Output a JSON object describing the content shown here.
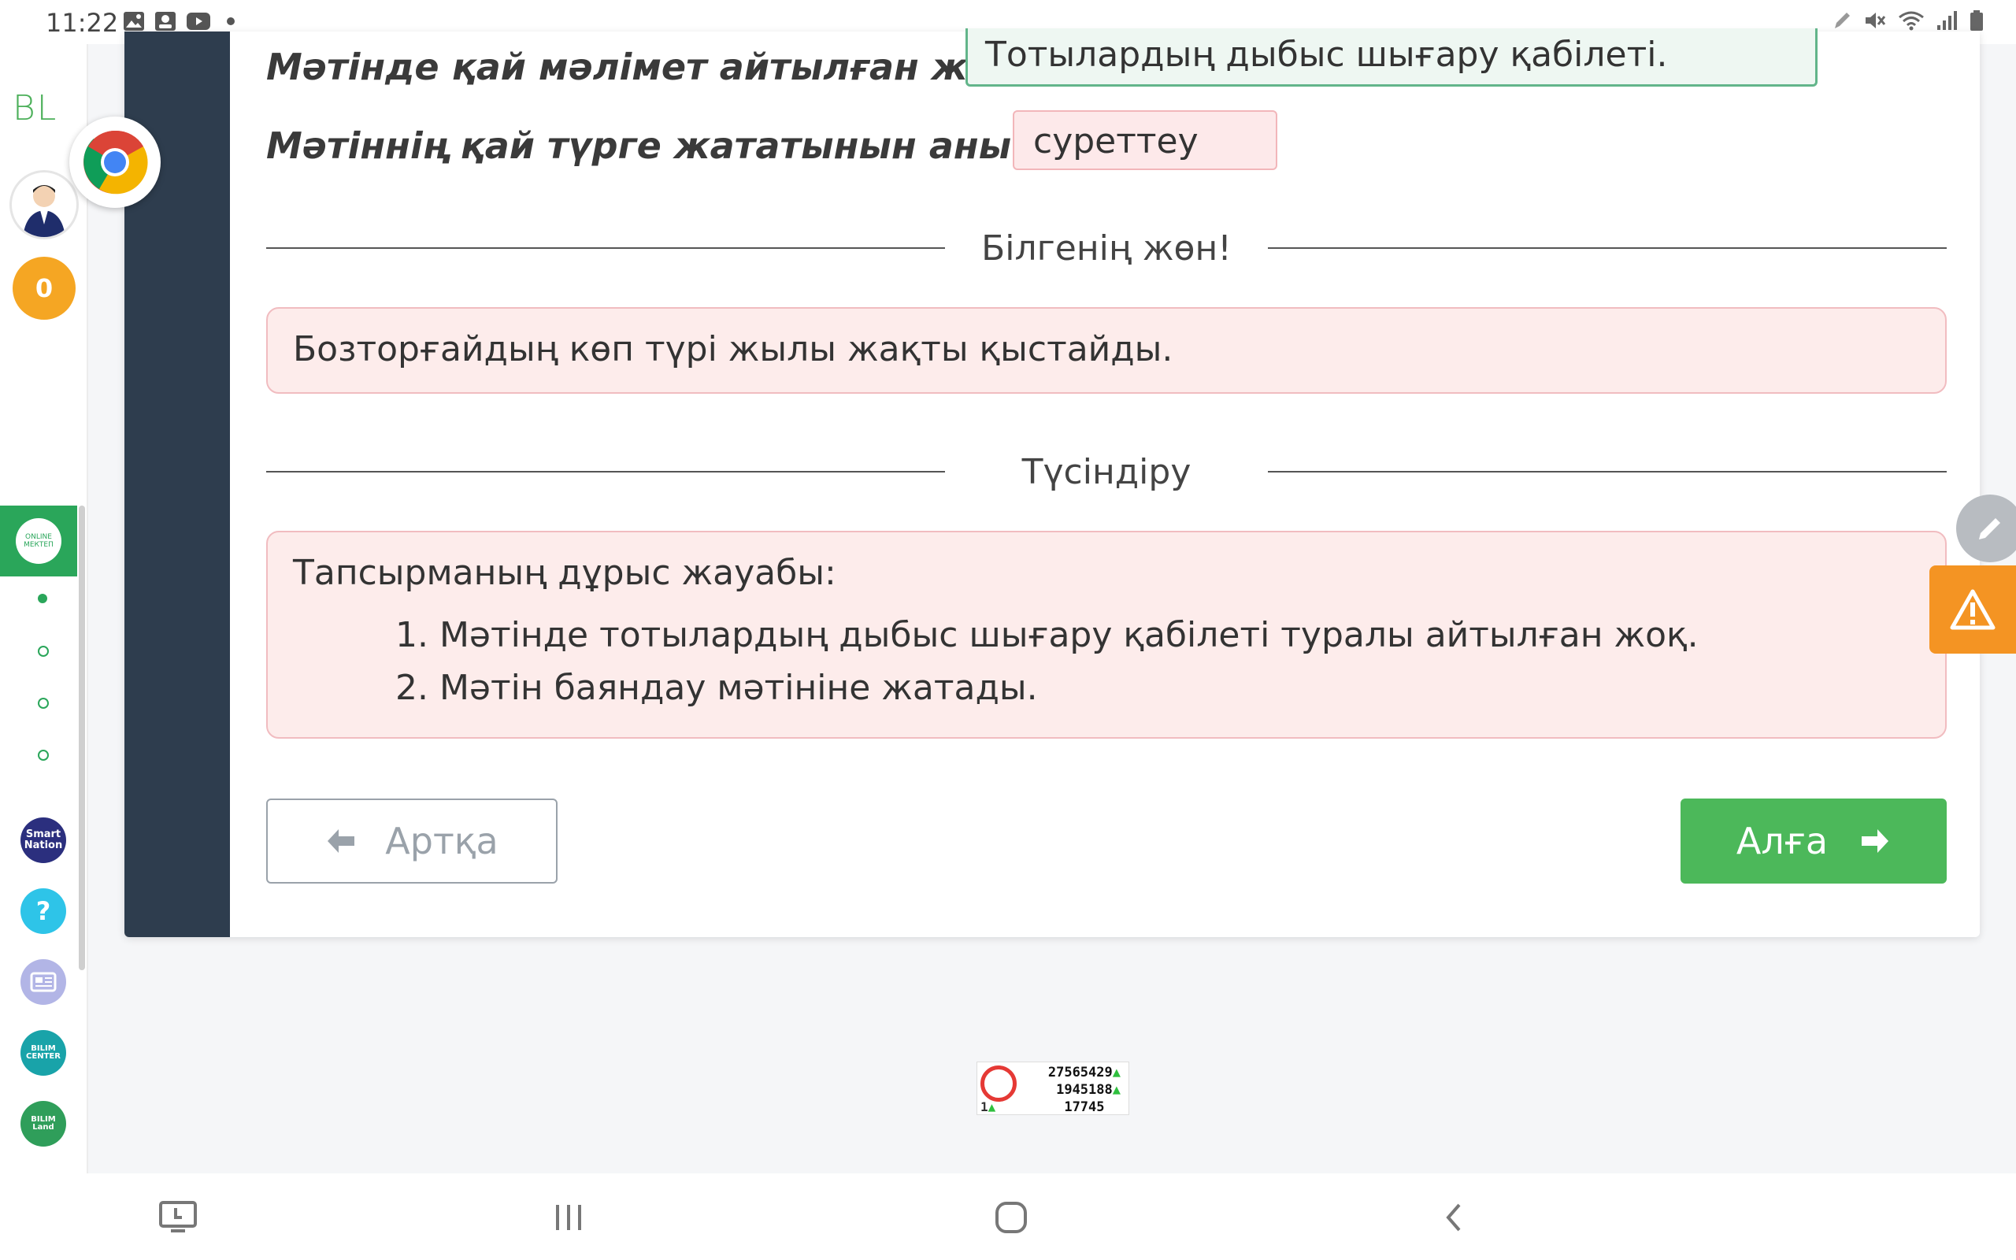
{
  "status_bar": {
    "time": "11:22",
    "icons": [
      "image-icon",
      "contact-icon",
      "youtube-icon",
      "dot-icon",
      "pen-icon",
      "mute-icon",
      "wifi-icon",
      "signal-icon",
      "battery-icon"
    ]
  },
  "sidebar": {
    "logo": "BL",
    "coins": "0",
    "online_label": "ONLINE МЕКТЕП",
    "smart_label": "Smart Nation",
    "help_label": "?",
    "bilim_center_label": "BILIM CENTER",
    "bilim_land_label": "BILIM Land"
  },
  "quiz": {
    "question1": "Мәтінде қай мәлімет айтылған жоқ?",
    "answer1": "Тотылардың дыбыс шығару қабілеті.",
    "question2": "Мәтіннің қай түрге жататынын анықта.",
    "answer2": "суреттеу",
    "known_heading": "Білгенің жөн!",
    "known_text": "Бозторғайдың көп түрі жылы жақты қыстайды.",
    "explain_heading": "Түсіндіру",
    "explain_title": "Тапсырманың дұрыс жауабы:",
    "explain_items": [
      "1. Мәтінде тотылардың дыбыс шығару қабілеті туралы айтылған жоқ.",
      "2. Мәтін баяндау мәтініне жатады."
    ],
    "back_label": "Артқа",
    "next_label": "Алға"
  },
  "counter": {
    "line1": "27565429",
    "line2": "1945188",
    "line3": "17745",
    "small": "1"
  },
  "colors": {
    "accent_green": "#4cb85a",
    "dark_sidebar": "#2e3d4e",
    "wrong_bg": "#fde9ea",
    "correct_border": "#62b58a",
    "warning": "#f49423"
  }
}
